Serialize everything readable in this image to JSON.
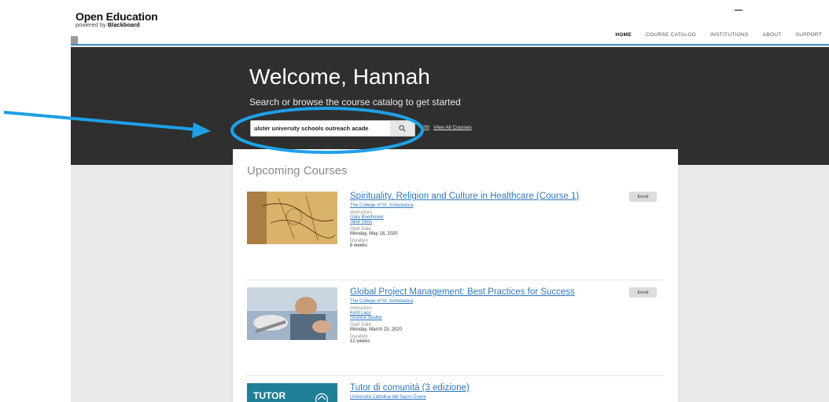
{
  "header": {
    "logo_title": "Open Education",
    "logo_sub_prefix": "powered by ",
    "logo_sub_brand": "Blackboard"
  },
  "nav": {
    "items": [
      {
        "label": "HOME",
        "active": true
      },
      {
        "label": "COURSE CATALOG",
        "active": false
      },
      {
        "label": "INSTITUTIONS",
        "active": false
      },
      {
        "label": "ABOUT",
        "active": false
      },
      {
        "label": "SUPPORT",
        "active": false
      }
    ]
  },
  "hero": {
    "welcome": "Welcome, Hannah",
    "subtitle": "Search or browse the course catalog to get started",
    "search_value": "ulster university schools outreach acade",
    "view_all_label": "View All Courses"
  },
  "upcoming": {
    "heading": "Upcoming Courses",
    "enroll_label": "Enroll",
    "instructors_label": "Instructors",
    "start_date_label": "Start Date",
    "duration_label": "Duration",
    "courses": [
      {
        "title": "Spirituality, Religion and Culture in Healthcare (Course 1)",
        "institution": "The College of St. Scholastica",
        "instructors": [
          "Gary Boelhower",
          "Jane Sims"
        ],
        "start_date": "Monday, May 18, 2020",
        "duration": "6 weeks"
      },
      {
        "title": "Global Project Management: Best Practices for Success",
        "institution": "The College of St. Scholastica",
        "instructors": [
          "Kent Lacy",
          "Shanna Skalter"
        ],
        "start_date": "Monday, March 23, 2020",
        "duration": "12 weeks"
      },
      {
        "title": "Tutor di comunità (3 edizione)",
        "institution": "Università Cattolica del Sacro Cuore",
        "thumb_text": "TUTOR"
      }
    ]
  },
  "colors": {
    "hero_bg": "#2f2f2f",
    "link": "#2f77bd",
    "annotation": "#1ea0e6",
    "accent_line": "#3d8fc9"
  }
}
